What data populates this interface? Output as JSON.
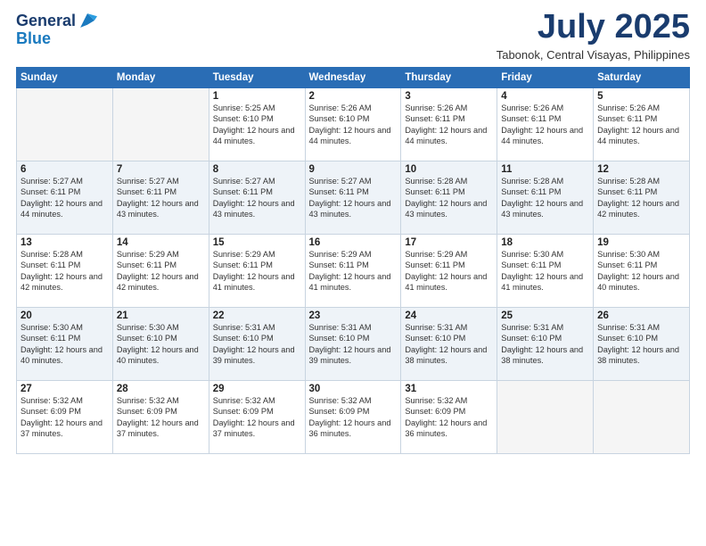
{
  "header": {
    "logo_line1": "General",
    "logo_line2": "Blue",
    "month": "July 2025",
    "location": "Tabonok, Central Visayas, Philippines"
  },
  "weekdays": [
    "Sunday",
    "Monday",
    "Tuesday",
    "Wednesday",
    "Thursday",
    "Friday",
    "Saturday"
  ],
  "weeks": [
    [
      {
        "day": "",
        "info": ""
      },
      {
        "day": "",
        "info": ""
      },
      {
        "day": "1",
        "info": "Sunrise: 5:25 AM\nSunset: 6:10 PM\nDaylight: 12 hours and 44 minutes."
      },
      {
        "day": "2",
        "info": "Sunrise: 5:26 AM\nSunset: 6:10 PM\nDaylight: 12 hours and 44 minutes."
      },
      {
        "day": "3",
        "info": "Sunrise: 5:26 AM\nSunset: 6:11 PM\nDaylight: 12 hours and 44 minutes."
      },
      {
        "day": "4",
        "info": "Sunrise: 5:26 AM\nSunset: 6:11 PM\nDaylight: 12 hours and 44 minutes."
      },
      {
        "day": "5",
        "info": "Sunrise: 5:26 AM\nSunset: 6:11 PM\nDaylight: 12 hours and 44 minutes."
      }
    ],
    [
      {
        "day": "6",
        "info": "Sunrise: 5:27 AM\nSunset: 6:11 PM\nDaylight: 12 hours and 44 minutes."
      },
      {
        "day": "7",
        "info": "Sunrise: 5:27 AM\nSunset: 6:11 PM\nDaylight: 12 hours and 43 minutes."
      },
      {
        "day": "8",
        "info": "Sunrise: 5:27 AM\nSunset: 6:11 PM\nDaylight: 12 hours and 43 minutes."
      },
      {
        "day": "9",
        "info": "Sunrise: 5:27 AM\nSunset: 6:11 PM\nDaylight: 12 hours and 43 minutes."
      },
      {
        "day": "10",
        "info": "Sunrise: 5:28 AM\nSunset: 6:11 PM\nDaylight: 12 hours and 43 minutes."
      },
      {
        "day": "11",
        "info": "Sunrise: 5:28 AM\nSunset: 6:11 PM\nDaylight: 12 hours and 43 minutes."
      },
      {
        "day": "12",
        "info": "Sunrise: 5:28 AM\nSunset: 6:11 PM\nDaylight: 12 hours and 42 minutes."
      }
    ],
    [
      {
        "day": "13",
        "info": "Sunrise: 5:28 AM\nSunset: 6:11 PM\nDaylight: 12 hours and 42 minutes."
      },
      {
        "day": "14",
        "info": "Sunrise: 5:29 AM\nSunset: 6:11 PM\nDaylight: 12 hours and 42 minutes."
      },
      {
        "day": "15",
        "info": "Sunrise: 5:29 AM\nSunset: 6:11 PM\nDaylight: 12 hours and 41 minutes."
      },
      {
        "day": "16",
        "info": "Sunrise: 5:29 AM\nSunset: 6:11 PM\nDaylight: 12 hours and 41 minutes."
      },
      {
        "day": "17",
        "info": "Sunrise: 5:29 AM\nSunset: 6:11 PM\nDaylight: 12 hours and 41 minutes."
      },
      {
        "day": "18",
        "info": "Sunrise: 5:30 AM\nSunset: 6:11 PM\nDaylight: 12 hours and 41 minutes."
      },
      {
        "day": "19",
        "info": "Sunrise: 5:30 AM\nSunset: 6:11 PM\nDaylight: 12 hours and 40 minutes."
      }
    ],
    [
      {
        "day": "20",
        "info": "Sunrise: 5:30 AM\nSunset: 6:11 PM\nDaylight: 12 hours and 40 minutes."
      },
      {
        "day": "21",
        "info": "Sunrise: 5:30 AM\nSunset: 6:10 PM\nDaylight: 12 hours and 40 minutes."
      },
      {
        "day": "22",
        "info": "Sunrise: 5:31 AM\nSunset: 6:10 PM\nDaylight: 12 hours and 39 minutes."
      },
      {
        "day": "23",
        "info": "Sunrise: 5:31 AM\nSunset: 6:10 PM\nDaylight: 12 hours and 39 minutes."
      },
      {
        "day": "24",
        "info": "Sunrise: 5:31 AM\nSunset: 6:10 PM\nDaylight: 12 hours and 38 minutes."
      },
      {
        "day": "25",
        "info": "Sunrise: 5:31 AM\nSunset: 6:10 PM\nDaylight: 12 hours and 38 minutes."
      },
      {
        "day": "26",
        "info": "Sunrise: 5:31 AM\nSunset: 6:10 PM\nDaylight: 12 hours and 38 minutes."
      }
    ],
    [
      {
        "day": "27",
        "info": "Sunrise: 5:32 AM\nSunset: 6:09 PM\nDaylight: 12 hours and 37 minutes."
      },
      {
        "day": "28",
        "info": "Sunrise: 5:32 AM\nSunset: 6:09 PM\nDaylight: 12 hours and 37 minutes."
      },
      {
        "day": "29",
        "info": "Sunrise: 5:32 AM\nSunset: 6:09 PM\nDaylight: 12 hours and 37 minutes."
      },
      {
        "day": "30",
        "info": "Sunrise: 5:32 AM\nSunset: 6:09 PM\nDaylight: 12 hours and 36 minutes."
      },
      {
        "day": "31",
        "info": "Sunrise: 5:32 AM\nSunset: 6:09 PM\nDaylight: 12 hours and 36 minutes."
      },
      {
        "day": "",
        "info": ""
      },
      {
        "day": "",
        "info": ""
      }
    ]
  ]
}
